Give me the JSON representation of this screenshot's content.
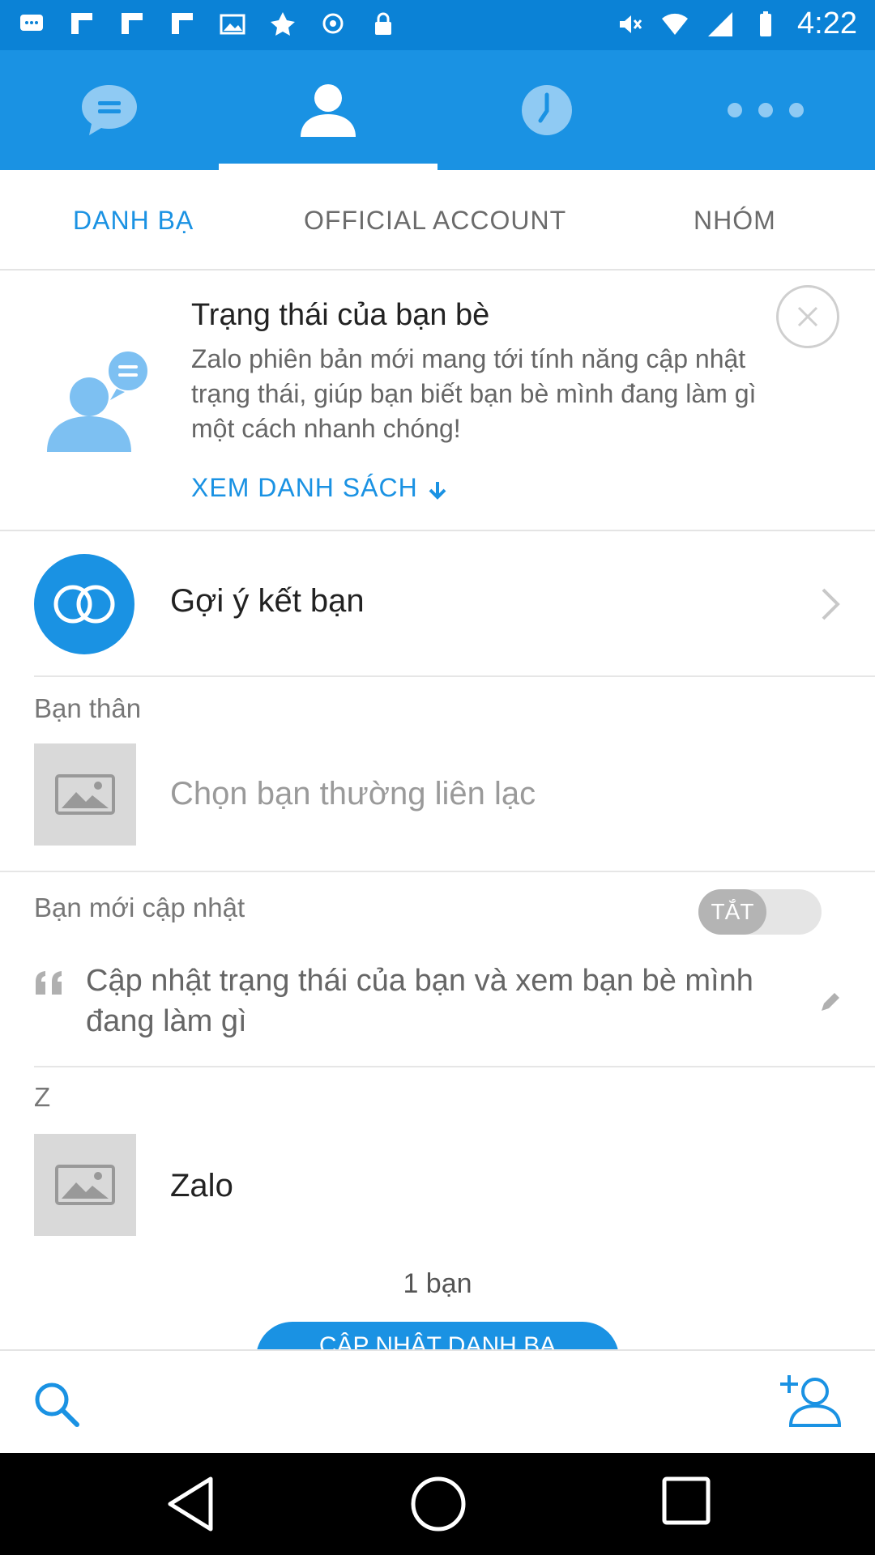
{
  "status_bar": {
    "time": "4:22",
    "icons_left": [
      "messages-icon",
      "flipboard-icon",
      "flipboard-icon",
      "flipboard-icon",
      "image-icon",
      "fake-gps-icon",
      "sync-icon",
      "lock-icon"
    ],
    "icons_right": [
      "mute-icon",
      "wifi-icon",
      "signal-icon",
      "battery-icon"
    ]
  },
  "top_tabs": [
    {
      "name": "chat",
      "icon": "chat-bubble-icon",
      "active": false
    },
    {
      "name": "contacts",
      "icon": "person-icon",
      "active": true
    },
    {
      "name": "timeline",
      "icon": "clock-icon",
      "active": false
    },
    {
      "name": "more",
      "icon": "more-dots-icon",
      "active": false
    }
  ],
  "sub_tabs": {
    "contacts": "DANH BẠ",
    "official": "OFFICIAL ACCOUNT",
    "groups": "NHÓM"
  },
  "status_card": {
    "title": "Trạng thái của bạn bè",
    "description": "Zalo phiên bản mới mang tới tính năng cập nhật trạng thái, giúp bạn biết bạn bè mình đang làm gì một cách nhanh chóng!",
    "link": "XEM DANH SÁCH"
  },
  "suggest": {
    "label": "Gợi ý kết bạn"
  },
  "close_friends": {
    "header": "Bạn thân",
    "placeholder": "Chọn bạn thường liên lạc"
  },
  "new_updates": {
    "header": "Bạn mới cập nhật",
    "toggle_label": "TẮT",
    "status_prompt": "Cập nhật trạng thái của bạn và xem bạn bè mình đang làm gì"
  },
  "contacts": {
    "letter": "Z",
    "items": [
      {
        "name": "Zalo"
      }
    ]
  },
  "footer": {
    "count": "1 bạn",
    "update_button": "CẬP NHẬT DANH BẠ"
  },
  "colors": {
    "accent": "#1a92e3",
    "status_bar": "#0b82d6"
  }
}
